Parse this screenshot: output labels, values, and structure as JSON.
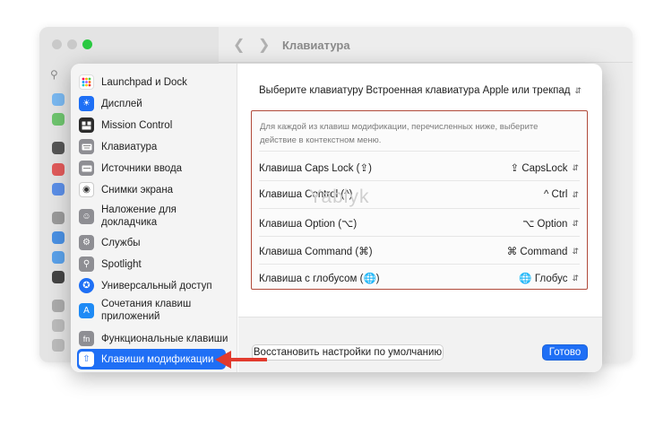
{
  "window": {
    "title": "Клавиатура"
  },
  "sidebar": {
    "items": [
      {
        "label": "Launchpad и Dock",
        "icon": "launchpad-icon",
        "color": "#3a3a3a"
      },
      {
        "label": "Дисплей",
        "icon": "display-icon",
        "color": "#1e6ff5"
      },
      {
        "label": "Mission Control",
        "icon": "mission-control-icon",
        "color": "#2b2b2b"
      },
      {
        "label": "Клавиатура",
        "icon": "keyboard-icon",
        "color": "#8e8e93"
      },
      {
        "label": "Источники ввода",
        "icon": "input-sources-icon",
        "color": "#8e8e93"
      },
      {
        "label": "Снимки экрана",
        "icon": "screenshot-icon",
        "color": "#ffffff"
      },
      {
        "label": "Наложение для докладчика",
        "icon": "presenter-overlay-icon",
        "color": "#8e8e93"
      },
      {
        "label": "Службы",
        "icon": "services-icon",
        "color": "#8e8e93"
      },
      {
        "label": "Spotlight",
        "icon": "spotlight-icon",
        "color": "#8e8e93"
      },
      {
        "label": "Универсальный доступ",
        "icon": "accessibility-icon",
        "color": "#1e6ff5"
      },
      {
        "label": "Сочетания клавиш приложений",
        "icon": "app-shortcuts-icon",
        "color": "#1e8af5"
      },
      {
        "label": "Функциональные клавиши",
        "icon": "function-keys-icon",
        "color": "#8e8e93"
      },
      {
        "label": "Клавиши модификации",
        "icon": "modifier-keys-icon",
        "color": "#ffffff"
      }
    ],
    "selected_index": 12
  },
  "keyboard_select": {
    "label": "Выберите клавиатуру",
    "value": "Встроенная клавиатура Apple или трекпад"
  },
  "modifiers": {
    "description": "Для каждой из клавиш модификации, перечисленных ниже, выберите действие в контекстном меню.",
    "rows": [
      {
        "label": "Клавиша Caps Lock (⇪)",
        "value": "⇪ CapsLock"
      },
      {
        "label": "Клавиша Control (^)",
        "value": "^ Ctrl"
      },
      {
        "label": "Клавиша Option (⌥)",
        "value": "⌥ Option"
      },
      {
        "label": "Клавиша Command (⌘)",
        "value": "⌘ Command"
      },
      {
        "label": "Клавиша с глобусом (🌐)",
        "value": "🌐 Глобус"
      }
    ]
  },
  "watermark": "Yablyk",
  "footer": {
    "restore_label": "Восстановить настройки по умолчанию",
    "done_label": "Готово"
  },
  "colors": {
    "accent": "#1f6ff5",
    "highlight_box": "#b04a3a",
    "arrow": "#e23b2e"
  }
}
